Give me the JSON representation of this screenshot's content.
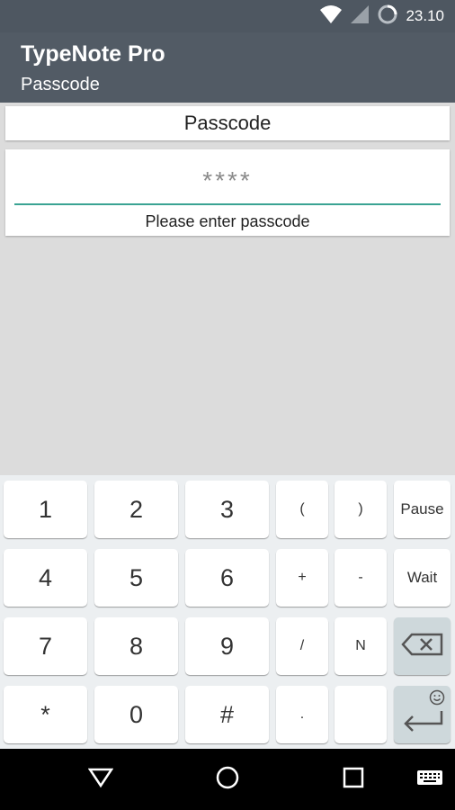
{
  "status": {
    "time": "23.10"
  },
  "app": {
    "title": "TypeNote Pro",
    "subtitle": "Passcode"
  },
  "content": {
    "card_title": "Passcode",
    "input_placeholder": "****",
    "input_value": "",
    "hint": "Please enter passcode"
  },
  "keypad": {
    "keys": [
      "1",
      "2",
      "3",
      "(",
      ")",
      "Pause",
      "4",
      "5",
      "6",
      "+",
      "-",
      "Wait",
      "7",
      "8",
      "9",
      "/",
      "N",
      "*",
      "0",
      "#",
      "."
    ]
  },
  "icons": {
    "wifi": "wifi-icon",
    "signal": "signal-icon",
    "battery": "battery-ring-icon",
    "backspace": "backspace-icon",
    "enter": "enter-icon",
    "emoji": "emoji-icon",
    "back": "back-icon",
    "home": "home-icon",
    "recents": "recents-icon",
    "keyboard": "keyboard-icon"
  },
  "colors": {
    "appbar": "#525b65",
    "accent": "#3aa393",
    "keypad_bg": "#eceff1"
  }
}
